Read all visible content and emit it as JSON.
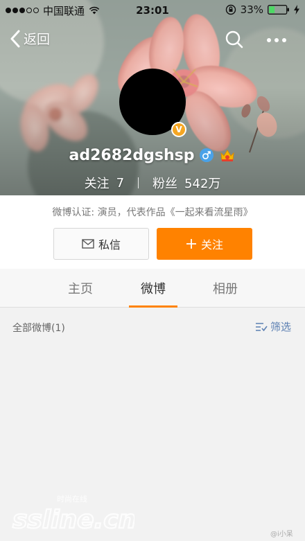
{
  "status_bar": {
    "carrier": "中国联通",
    "time": "23:01",
    "battery": "33%",
    "battery_level": 0.33
  },
  "nav": {
    "back_label": "返回"
  },
  "profile": {
    "username": "ad2682dgshsp",
    "stats": {
      "following_label": "关注",
      "following_count": "7",
      "followers_label": "粉丝",
      "followers_count": "542万"
    },
    "certification": "微博认证: 演员，代表作品《一起来看流星雨》",
    "verified_badge": "V"
  },
  "actions": {
    "message_label": "私信",
    "follow_label": "关注"
  },
  "tabs": [
    {
      "label": "主页"
    },
    {
      "label": "微博"
    },
    {
      "label": "相册"
    }
  ],
  "active_tab": 1,
  "filter_row": {
    "all_posts_label": "全部微博(1)",
    "filter_label": "筛选"
  },
  "watermark": {
    "site": "ssline.cn",
    "tagline": "时尚在线",
    "handle": "@i小呆"
  },
  "colors": {
    "accent_orange": "#ff8200",
    "link_blue": "#5b7fb2",
    "verified_gold": "#f5a623",
    "male_blue": "#4aa2e8"
  }
}
